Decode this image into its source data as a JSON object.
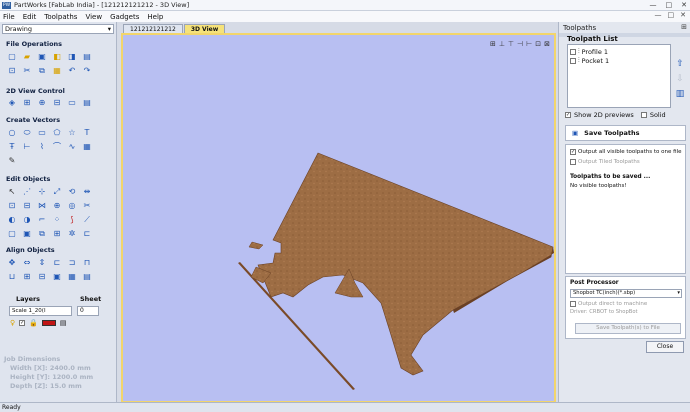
{
  "window": {
    "app_badge": "PW",
    "title": "PartWorks [FabLab India] - [121212121212 - 3D View]",
    "controls": [
      "—",
      "□",
      "✕"
    ]
  },
  "menu": {
    "items": [
      "File",
      "Edit",
      "Toolpaths",
      "View",
      "Gadgets",
      "Help"
    ],
    "right_controls": [
      "—",
      "□",
      "✕"
    ]
  },
  "left_panel": {
    "mode_select": "Drawing",
    "sections": {
      "file_operations": "File Operations",
      "view_control": "2D View Control",
      "create_vectors": "Create Vectors",
      "edit_objects": "Edit Objects",
      "align_objects": "Align Objects"
    },
    "layers_label": "Layers",
    "sheet_label": "Sheet",
    "layer_value": "Scale 1_20(I",
    "sheet_value": "0",
    "job_dimensions": {
      "title": "Job Dimensions",
      "width": "Width  [X]: 2400.0 mm",
      "height": "Height [Y]: 1200.0 mm",
      "depth": "Depth  [Z]: 15.0 mm"
    }
  },
  "view": {
    "tabs": [
      "121212121212",
      "3D View"
    ],
    "active_tab": "3D View",
    "background": "#b8bff2",
    "material_color": "#9d6d44"
  },
  "toolpaths_panel": {
    "title": "Toolpaths",
    "list_title": "Toolpath List",
    "items": [
      {
        "name": "Profile 1",
        "checked": false
      },
      {
        "name": "Pocket 1",
        "checked": false
      }
    ],
    "show_2d_previews": "Show 2D previews",
    "solid": "Solid",
    "save_toolpaths": "Save Toolpaths",
    "output_all": "Output all visible toolpaths to one file",
    "output_tiled": "Output Tiled Toolpaths",
    "to_be_saved_title": "Toolpaths to be saved ...",
    "to_be_saved_text": "No visible toolpaths!",
    "post_processor_title": "Post Processor",
    "post_processor_value": "Shopbot TC(inch)(*.sbp)",
    "output_to_machine": "Output direct to machine",
    "driver": "Driver: CRBOT to ShopBot",
    "save_to_file": "Save Toolpath(s) to File",
    "close": "Close"
  },
  "status": {
    "text": "Ready"
  }
}
